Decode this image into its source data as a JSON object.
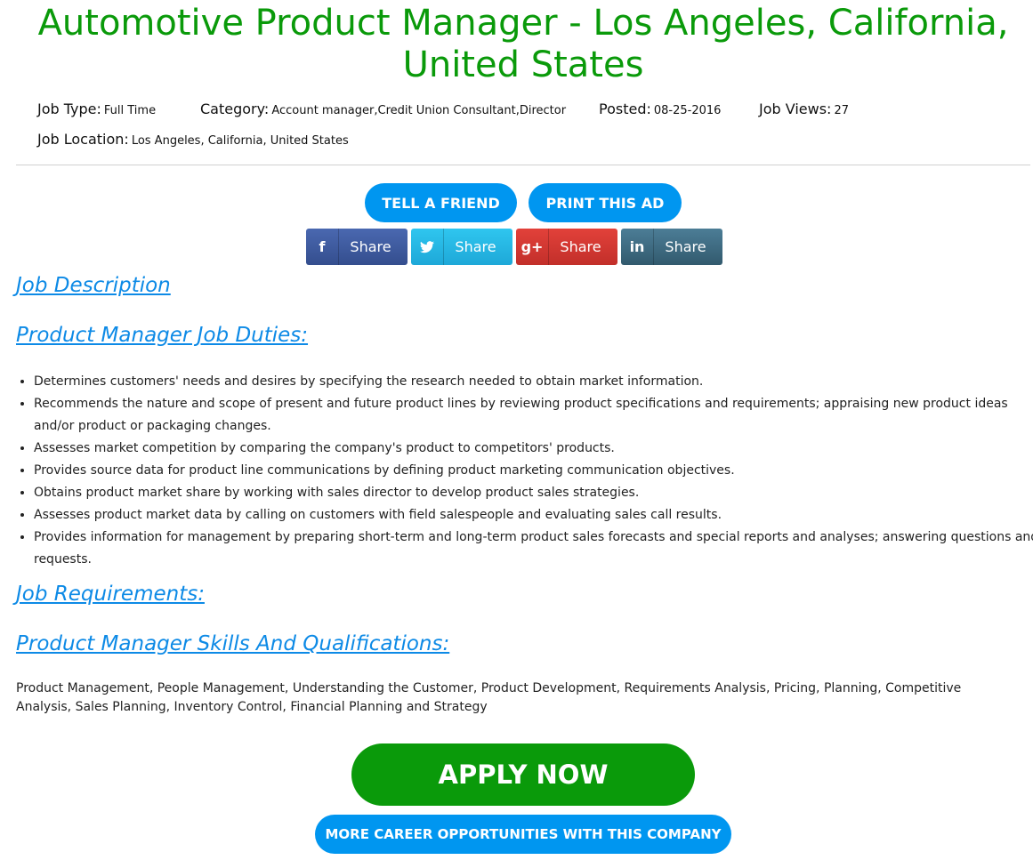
{
  "page": {
    "title": "Automotive Product Manager - Los Angeles, California, United States"
  },
  "meta": {
    "job_type_label": "Job Type:",
    "job_type_value": "Full Time",
    "category_label": "Category:",
    "category_value": "Account manager,Credit Union Consultant,Director",
    "posted_label": "Posted:",
    "posted_value": "08-25-2016",
    "views_label": "Job Views:",
    "views_value": "27",
    "location_label": "Job Location:",
    "location_value": "Los Angeles, California, United States"
  },
  "actions": {
    "tell_friend": "TELL A FRIEND",
    "print_ad": "PRINT THIS AD",
    "apply": "APPLY NOW",
    "more_careers": "MORE CAREER OPPORTUNITIES WITH THIS COMPANY"
  },
  "share": [
    {
      "icon": "facebook-icon",
      "glyph": "f",
      "label": "Share"
    },
    {
      "icon": "twitter-icon",
      "glyph": "t",
      "label": "Share"
    },
    {
      "icon": "google-plus-icon",
      "glyph": "g+",
      "label": "Share"
    },
    {
      "icon": "linkedin-icon",
      "glyph": "in",
      "label": "Share"
    }
  ],
  "sections": {
    "description_heading": "Job Description",
    "duties_heading": "Product Manager Job Duties:",
    "requirements_heading": "Job Requirements:",
    "skills_heading": "Product Manager Skills And Qualifications:"
  },
  "duties": [
    "Determines customers' needs and desires by specifying the research needed to obtain market information.",
    "Recommends the nature and scope of present and future product lines by reviewing product specifications and requirements; appraising new product ideas and/or product or packaging changes.",
    "Assesses market competition by comparing the company's product to competitors' products.",
    "Provides source data for product line communications by defining product marketing communication objectives.",
    "Obtains product market share by working with sales director to develop product sales strategies.",
    "Assesses product market data by calling on customers with field salespeople and evaluating sales call results.",
    "Provides information for management by preparing short-term and long-term product sales forecasts and special reports and analyses; answering questions and requests."
  ],
  "skills_text": "Product Management, People Management, Understanding the Customer, Product Development, Requirements Analysis, Pricing, Planning, Competitive Analysis, Sales Planning, Inventory Control, Financial Planning and Strategy",
  "colors": {
    "title_green": "#0a9a0a",
    "accent_blue": "#0096f0",
    "heading_blue": "#0d8ae6",
    "facebook": "#3b5998",
    "twitter": "#26b6e5",
    "google_plus": "#d23a33",
    "linkedin": "#3f6a80"
  }
}
